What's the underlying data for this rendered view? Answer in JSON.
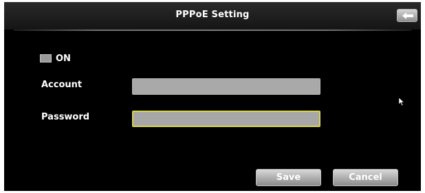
{
  "header": {
    "title": "PPPoE Setting",
    "back_icon": "back-arrow-icon"
  },
  "connection": {
    "on_label": "ON",
    "on_checked": false
  },
  "form": {
    "account_label": "Account",
    "account_value": "",
    "password_label": "Password",
    "password_value": ""
  },
  "actions": {
    "save_label": "Save",
    "cancel_label": "Cancel"
  },
  "colors": {
    "background": "#000000",
    "field": "#a9a9a9",
    "focus_border": "#d8d84a",
    "button": "#b0b0b0"
  }
}
